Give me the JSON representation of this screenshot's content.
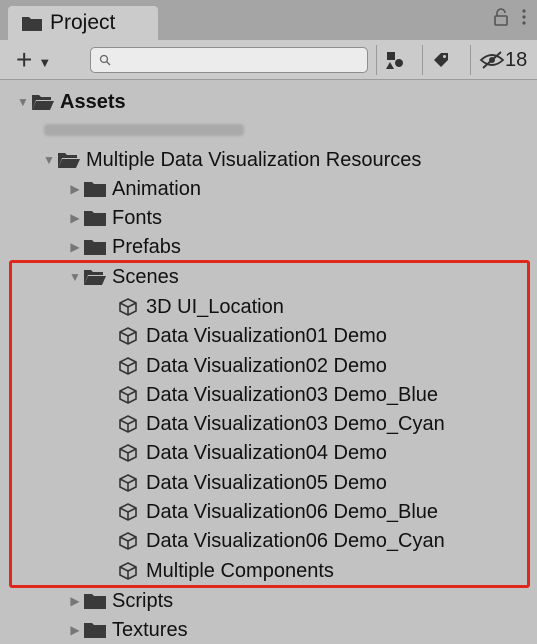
{
  "tab": {
    "title": "Project"
  },
  "toolbar": {
    "hidden_count": "18",
    "search_placeholder": ""
  },
  "tree": {
    "assets": "Assets",
    "root_folder": "Multiple Data Visualization Resources",
    "folders_before": [
      "Animation",
      "Fonts",
      "Prefabs"
    ],
    "scenes_folder": "Scenes",
    "scenes": [
      "3D UI_Location",
      "Data Visualization01 Demo",
      "Data Visualization02 Demo",
      "Data Visualization03 Demo_Blue",
      "Data Visualization03 Demo_Cyan",
      "Data Visualization04 Demo",
      "Data Visualization05 Demo",
      "Data Visualization06 Demo_Blue",
      "Data Visualization06 Demo_Cyan",
      "Multiple Components"
    ],
    "folders_after": [
      "Scripts",
      "Textures"
    ]
  },
  "colors": {
    "highlight": "#e1261c",
    "panel": "#c2c2c2"
  }
}
